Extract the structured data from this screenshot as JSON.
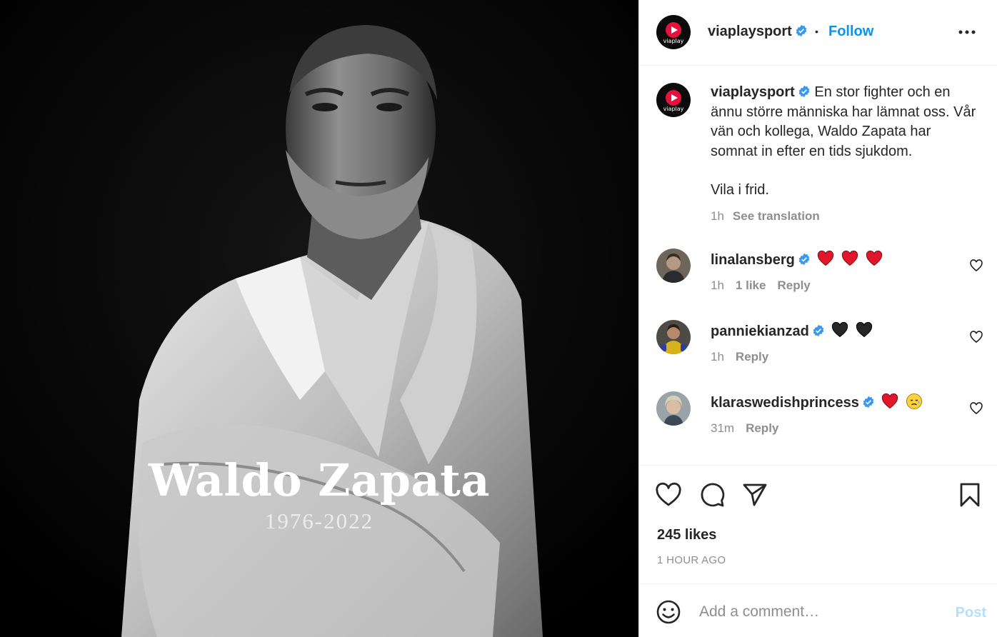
{
  "post_image": {
    "name_text": "Waldo Zapata",
    "years_text": "1976-2022"
  },
  "header": {
    "avatar_wordmark": "viaplay",
    "username": "viaplaysport",
    "separator": "•",
    "follow_label": "Follow",
    "more_icon": "more-horizontal-icon"
  },
  "caption": {
    "username": "viaplaysport",
    "line1": "En stor fighter och en ännu större människa har lämnat oss. Vår vän och kollega, Waldo Zapata har somnat in efter en tids sjukdom.",
    "line2": "Vila i frid.",
    "time": "1h",
    "see_translation": "See translation"
  },
  "comments": [
    {
      "username": "linalansberg",
      "emojis": [
        "red-heart",
        "red-heart",
        "red-heart"
      ],
      "time": "1h",
      "likes": "1 like",
      "reply": "Reply"
    },
    {
      "username": "panniekianzad",
      "emojis": [
        "black-heart",
        "black-heart"
      ],
      "time": "1h",
      "likes": "",
      "reply": "Reply"
    },
    {
      "username": "klaraswedishprincess",
      "emojis": [
        "red-heart",
        "sad-relieved-face"
      ],
      "time": "31m",
      "likes": "",
      "reply": "Reply"
    }
  ],
  "actions": {
    "likes": "245 likes",
    "ago": "1 HOUR AGO"
  },
  "comment_bar": {
    "placeholder": "Add a comment…",
    "post_label": "Post"
  },
  "colors": {
    "link_blue": "#0095f6",
    "post_disabled": "#b2dffc",
    "verified_blue": "#3897f0",
    "brand_red": "#e8113d",
    "heart_red": "#e0162b"
  }
}
